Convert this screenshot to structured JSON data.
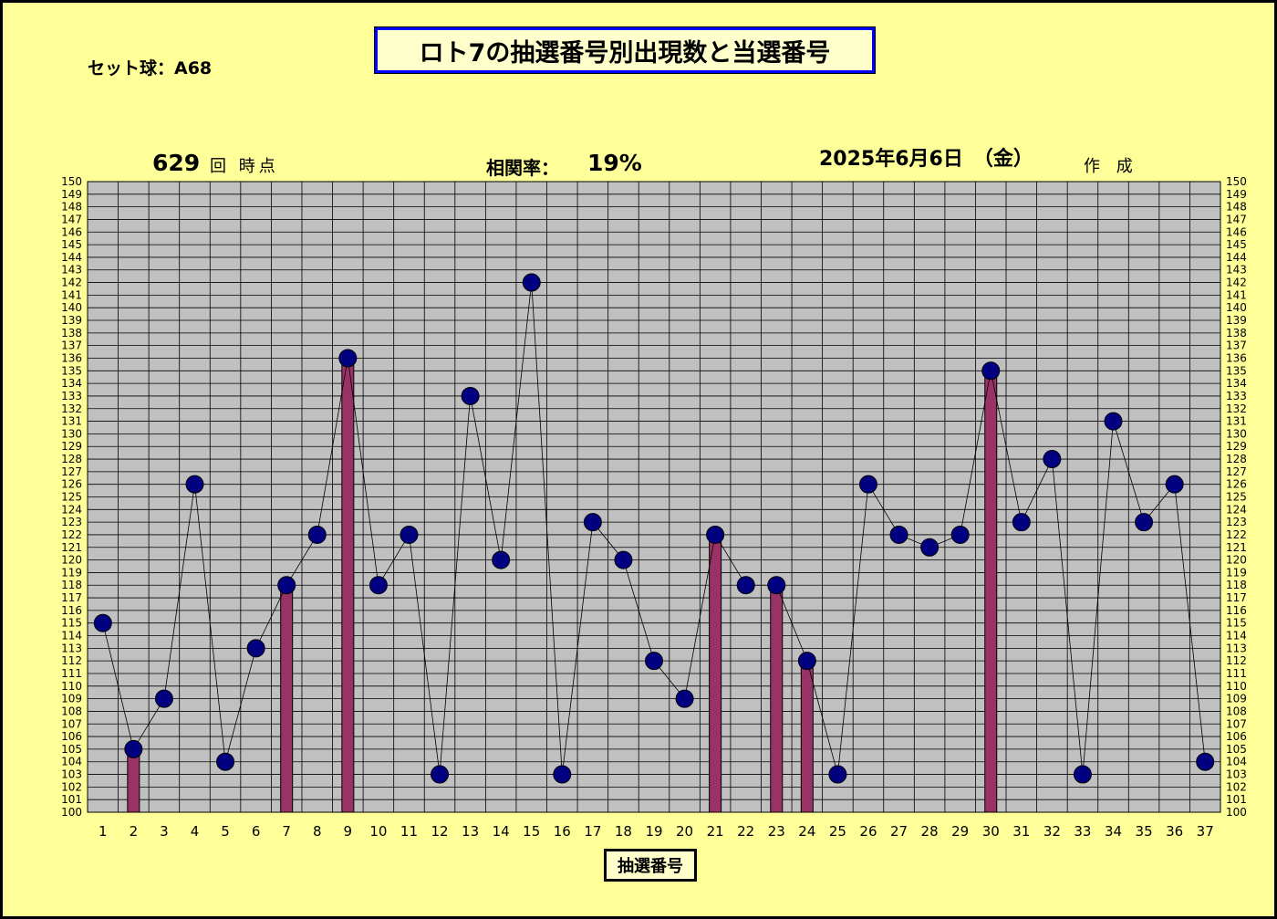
{
  "header": {
    "title": "ロト7の抽選番号別出現数と当選番号",
    "set_ball": "セット球：A68",
    "round_number": "629",
    "round_suffix": "回 時点",
    "correlation_label": "相関率：",
    "correlation_value": "19%",
    "date": "2025年6月6日　（金）",
    "made_label": "作 成"
  },
  "colors": {
    "background": "#ffff99",
    "plot_area": "#c0c0c0",
    "title_border": "#0000ff",
    "marker": "#000080",
    "bar": "#993366",
    "line": "#000000"
  },
  "chart_data": {
    "type": "bar+line",
    "xlabel": "抽選番号",
    "ylim": [
      100,
      150
    ],
    "categories": [
      1,
      2,
      3,
      4,
      5,
      6,
      7,
      8,
      9,
      10,
      11,
      12,
      13,
      14,
      15,
      16,
      17,
      18,
      19,
      20,
      21,
      22,
      23,
      24,
      25,
      26,
      27,
      28,
      29,
      30,
      31,
      32,
      33,
      34,
      35,
      36,
      37
    ],
    "series": [
      {
        "kind": "line",
        "values": [
          115,
          105,
          109,
          126,
          104,
          113,
          118,
          122,
          136,
          118,
          122,
          103,
          133,
          120,
          142,
          103,
          123,
          120,
          112,
          109,
          122,
          118,
          118,
          112,
          103,
          126,
          122,
          121,
          122,
          135,
          123,
          128,
          103,
          131,
          123,
          126,
          104
        ]
      },
      {
        "kind": "bar",
        "values": [
          null,
          105,
          null,
          null,
          null,
          null,
          118,
          null,
          136,
          null,
          null,
          null,
          null,
          null,
          null,
          null,
          null,
          null,
          null,
          null,
          122,
          null,
          118,
          112,
          null,
          null,
          null,
          null,
          null,
          135,
          null,
          null,
          null,
          null,
          null,
          null,
          null
        ]
      }
    ],
    "yticks_left": true,
    "yticks_right": true,
    "grid": true
  }
}
